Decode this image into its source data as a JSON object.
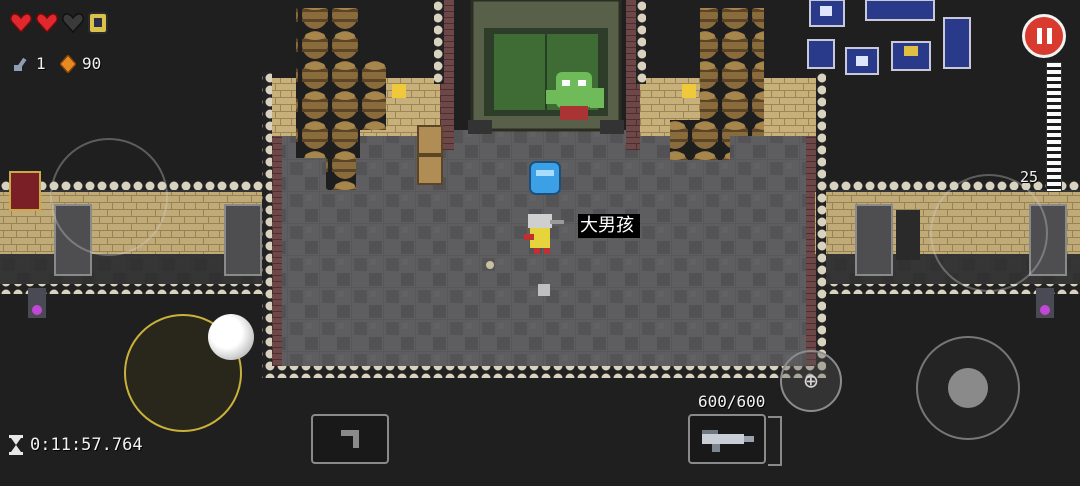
{
  "hud": {
    "hearts_full": 2,
    "hearts_total": 3,
    "keys_count": "1",
    "coins_count": "90",
    "timer": "0:11:57.764"
  },
  "weapon": {
    "ammo": "600/600",
    "clip_remaining": "25",
    "primary": "machine-gun",
    "secondary": "boomerang"
  },
  "player": {
    "name_tag": "大男孩"
  },
  "colors": {
    "floor": "#58585a",
    "stone_wall": "#c9b37a",
    "pause_red": "#d83a2e",
    "heart_red": "#e0282e"
  },
  "icons": {
    "heart": "heart-icon",
    "armor": "armor-icon",
    "key": "key-icon",
    "coin": "coin-icon",
    "pause": "pause-icon",
    "hourglass": "hourglass-icon"
  }
}
